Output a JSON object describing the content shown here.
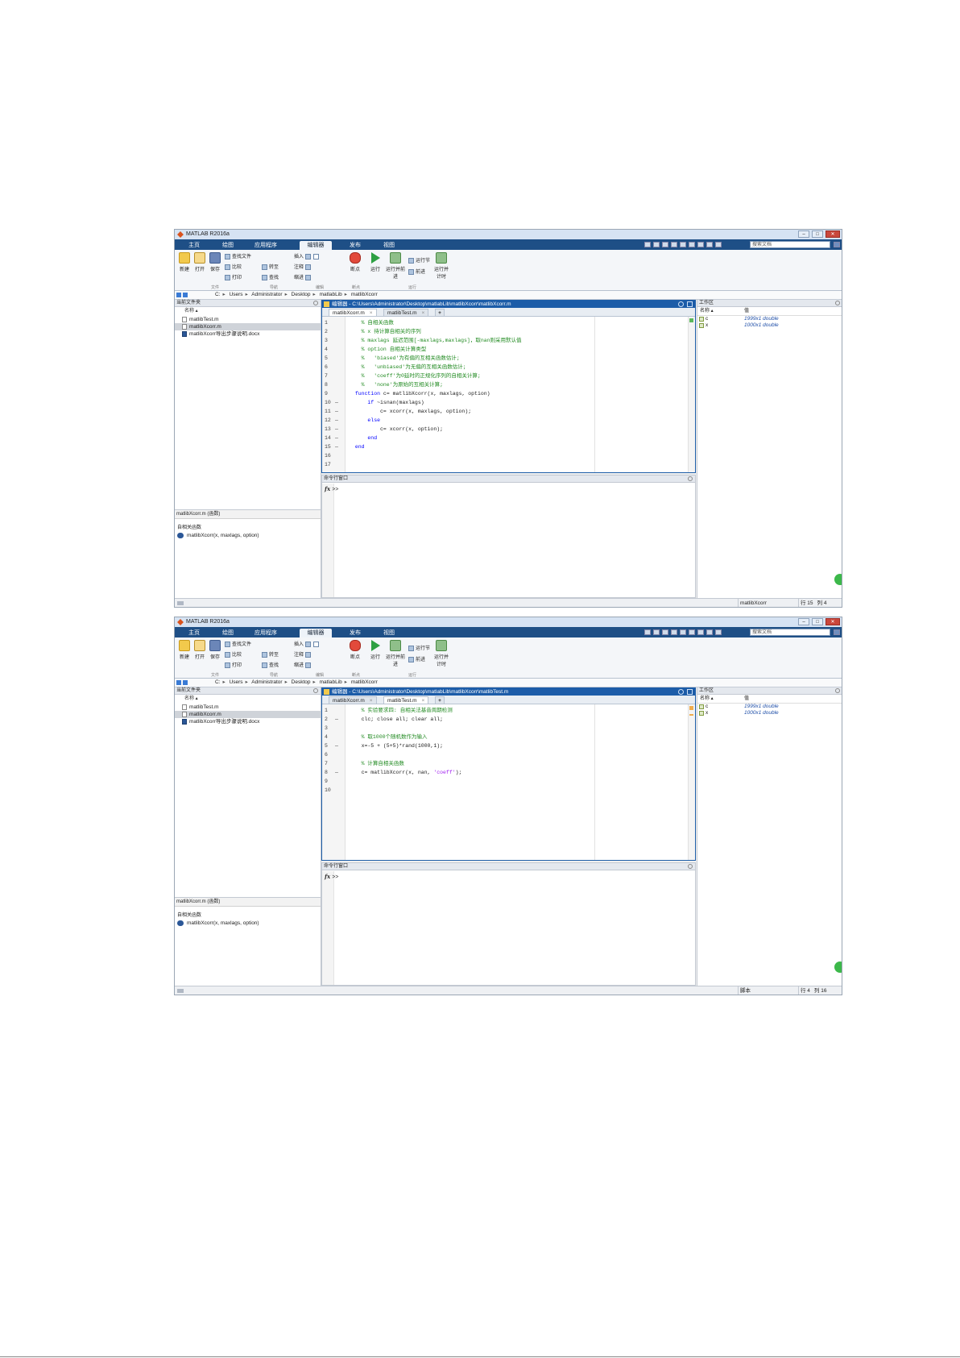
{
  "app": {
    "window_title": "MATLAB R2016a",
    "tabs": [
      "主页",
      "绘图",
      "应用程序",
      "编辑器",
      "发布",
      "视图"
    ],
    "active_tab": "编辑器",
    "search_placeholder": "搜索文档",
    "ribbon": {
      "new": "新建",
      "open": "打开",
      "save": "保存",
      "find_files": "查找文件",
      "compare": "比较",
      "print": "打印",
      "insert": "插入",
      "comment": "注释",
      "indent": "缩进",
      "goto": "转至",
      "find": "查找",
      "breakpoints": "断点",
      "run": "运行",
      "run_and_advance": "运行并前进",
      "run_section": "运行节",
      "advance": "前进",
      "run_and_time": "运行并计时",
      "groups": [
        "文件",
        "导航",
        "编辑",
        "断点",
        "运行"
      ]
    },
    "breadcrumb": [
      "C:",
      "Users",
      "Administrator",
      "Desktop",
      "matlabLib",
      "matlibXcorr"
    ],
    "current_folder_title": "当前文件夹",
    "name_header": "名称 ▴",
    "files": [
      "matlibTest.m",
      "matlibXcorr.m",
      "matlibXcorr导出步骤说明.docx"
    ],
    "details_header": "matlibXcorr.m (函数)",
    "details_desc": "自相关函数",
    "details_fn": "matlibXcorr(x, maxlags, option)",
    "editor_tabs": [
      "matlibXcorr.m",
      "matlibTest.m"
    ],
    "cmd_title": "命令行窗口",
    "cmd_prompt": ">>",
    "workspace_title": "工作区",
    "ws_name_header": "名称 ▴",
    "ws_value_header": "值",
    "workspace": [
      {
        "name": "c",
        "value": "1999x1 double"
      },
      {
        "name": "x",
        "value": "1000x1 double"
      }
    ]
  },
  "screens": [
    {
      "editor_path": "编辑器 - C:\\Users\\Administrator\\Desktop\\matlabLib\\matlibXcorr\\matlibXcorr.m",
      "active_editor_tab": 0,
      "lines": [
        {
          "n": "1",
          "t": "    % 自相关函数",
          "c": "cmt"
        },
        {
          "n": "2",
          "t": "    % x 待计算自相关的序列",
          "c": "cmt"
        },
        {
          "n": "3",
          "t": "    % maxlags 延迟范围[-maxlags,maxlags]，取nan则采用默认值",
          "c": "cmt"
        },
        {
          "n": "4",
          "t": "    % option 自相关计算类型",
          "c": "cmt"
        },
        {
          "n": "5",
          "t": "    %   'biased'为有偏的互相关函数估计;",
          "c": "cmt"
        },
        {
          "n": "6",
          "t": "    %   'unbiased'为无偏的互相关函数估计;",
          "c": "cmt"
        },
        {
          "n": "7",
          "t": "    %   'coeff'为0延时的正规化序列的自相关计算;",
          "c": "cmt"
        },
        {
          "n": "8",
          "t": "    %   'none'为原始的互相关计算;",
          "c": "cmt"
        },
        {
          "n": "9",
          "t": "  function c= matlibXcorr(x, maxlags, option)",
          "c": "fn"
        },
        {
          "n": "10",
          "t": "      if ~isnan(maxlags)",
          "c": "if"
        },
        {
          "n": "11",
          "t": "          c= xcorr(x, maxlags, option);",
          "c": ""
        },
        {
          "n": "12",
          "t": "      else",
          "c": "kw"
        },
        {
          "n": "13",
          "t": "          c= xcorr(x, option);",
          "c": ""
        },
        {
          "n": "14",
          "t": "      end",
          "c": "kw"
        },
        {
          "n": "15",
          "t": "  end",
          "c": "kw"
        },
        {
          "n": "16",
          "t": "",
          "c": ""
        },
        {
          "n": "17",
          "t": "",
          "c": ""
        }
      ],
      "dash_lines": [
        "10",
        "11",
        "12",
        "13",
        "14",
        "15"
      ],
      "status_script": "matlibXcorr",
      "status_row": "行 15",
      "status_col": "列 4"
    },
    {
      "editor_path": "编辑器 - C:\\Users\\Administrator\\Desktop\\matlabLib\\matlibXcorr\\matlibTest.m",
      "active_editor_tab": 1,
      "lines": [
        {
          "n": "1",
          "t": "    % 实验要求四: 自相关法基音周期检测",
          "c": "cmt"
        },
        {
          "n": "2",
          "t": "    clc; close all; clear all;",
          "c": "clc"
        },
        {
          "n": "3",
          "t": "",
          "c": ""
        },
        {
          "n": "4",
          "t": "    % 取1000个随机数作为输入",
          "c": "cmt"
        },
        {
          "n": "5",
          "t": "    x=-5 + (5+5)*rand(1000,1);",
          "c": ""
        },
        {
          "n": "6",
          "t": "",
          "c": ""
        },
        {
          "n": "7",
          "t": "    % 计算自相关函数",
          "c": "cmt"
        },
        {
          "n": "8",
          "t": "    c= matlibXcorr(x, nan, 'coeff');",
          "c": "call"
        },
        {
          "n": "9",
          "t": "",
          "c": ""
        },
        {
          "n": "10",
          "t": "",
          "c": ""
        }
      ],
      "dash_lines": [
        "2",
        "5",
        "8"
      ],
      "status_script": "脚本",
      "status_row": "行 4",
      "status_col": "列 16"
    }
  ],
  "colors": {
    "tabbar": "#1e4f86",
    "editor_header": "#1c5ca8",
    "comment": "#228b22",
    "keyword": "#0000ff",
    "string": "#a020f0"
  }
}
